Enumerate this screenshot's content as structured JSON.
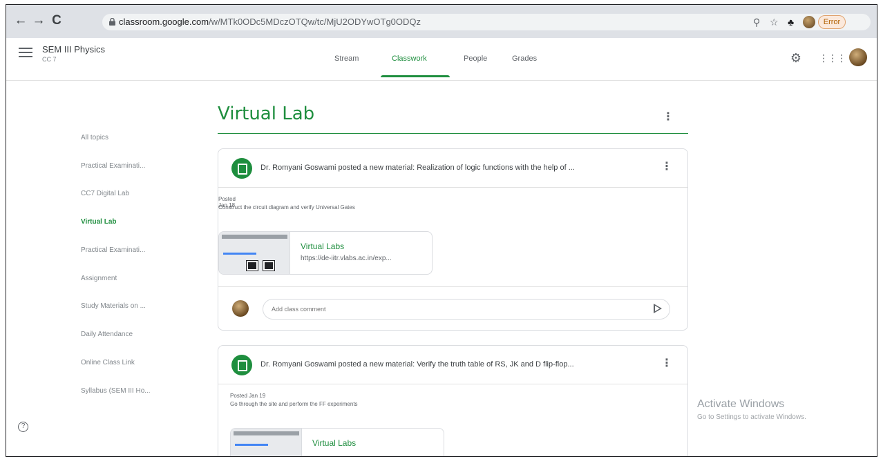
{
  "browser": {
    "url_host": "classroom.google.com",
    "url_path": "/w/MTk0ODc5MDczOTQw/tc/MjU2ODYwOTg0ODQz",
    "error_label": "Error",
    "back_glyph": "←",
    "forward_glyph": "→",
    "reload_glyph": "C"
  },
  "header": {
    "class_title": "SEM III Physics",
    "class_subtitle": "CC 7",
    "tabs": [
      {
        "label": "Stream"
      },
      {
        "label": "Classwork"
      },
      {
        "label": "People"
      },
      {
        "label": "Grades"
      }
    ],
    "active_tab": "Classwork"
  },
  "sidebar": {
    "topics": [
      {
        "label": "All topics"
      },
      {
        "label": "Practical Examinati..."
      },
      {
        "label": "CC7 Digital Lab"
      },
      {
        "label": "Virtual Lab"
      },
      {
        "label": "Practical Examinati..."
      },
      {
        "label": "Assignment"
      },
      {
        "label": "Study Materials on ..."
      },
      {
        "label": "Daily Attendance"
      },
      {
        "label": "Online Class Link"
      },
      {
        "label": "Syllabus (SEM III Ho..."
      }
    ],
    "active_topic": "Virtual Lab"
  },
  "section": {
    "title": "Virtual Lab"
  },
  "posts": [
    {
      "title": "Dr. Romyani Goswami posted a new material: Realization of logic functions with the help of ...",
      "posted": "Posted Jan 18",
      "description": "Construct the circuit diagram and verify Universal Gates",
      "attachment_title": "Virtual Labs",
      "attachment_url": "https://de-iitr.vlabs.ac.in/exp...",
      "comment_placeholder": "Add class comment"
    },
    {
      "title": "Dr. Romyani Goswami posted a new material: Verify the truth table of RS, JK and D flip-flop...",
      "posted": "Posted Jan 19",
      "description": "Go through the site and perform the FF experiments",
      "attachment_title": "Virtual Labs"
    }
  ],
  "watermark": {
    "title": "Activate Windows",
    "subtitle": "Go to Settings to activate Windows."
  },
  "colors": {
    "accent": "#1e8e3e",
    "chrome": "#dee1e6"
  },
  "icons": [
    "back-icon",
    "forward-icon",
    "reload-icon",
    "lock-icon",
    "zoom-icon",
    "star-icon",
    "extension-icon",
    "menu-icon",
    "settings-icon",
    "apps-icon",
    "help-icon",
    "material-icon",
    "more-vert-icon",
    "send-icon"
  ]
}
